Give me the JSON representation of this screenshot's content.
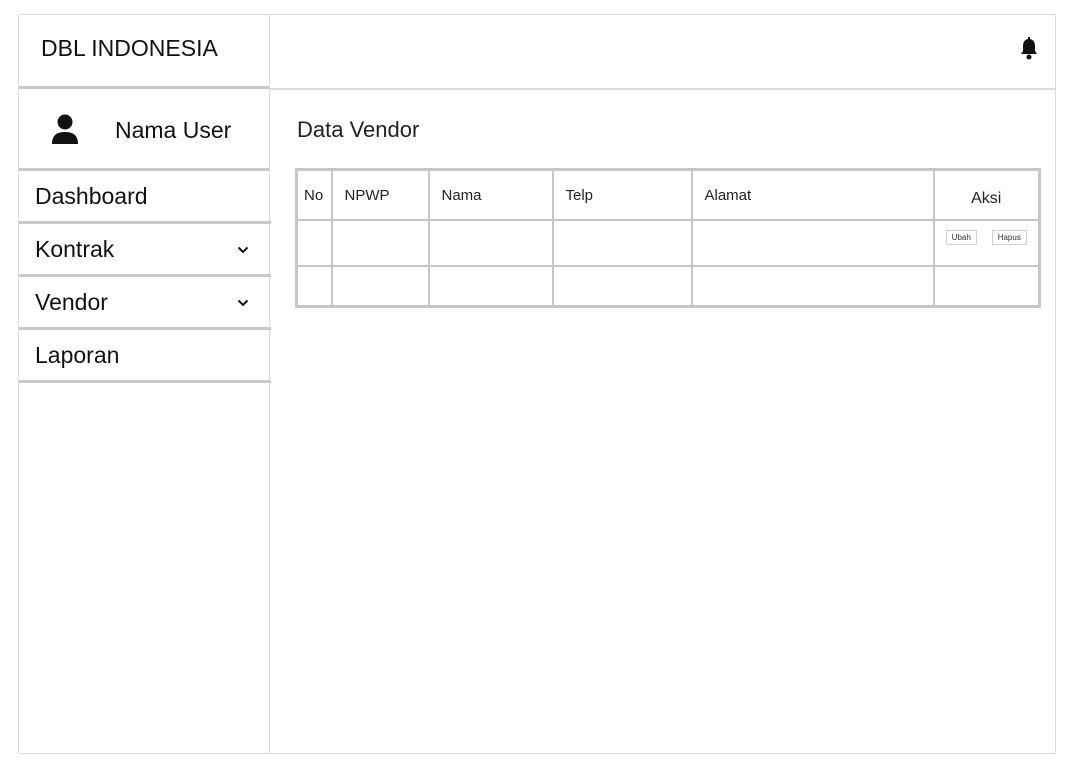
{
  "sidebar": {
    "brand": "DBL INDONESIA",
    "user_name": "Nama User",
    "items": [
      {
        "label": "Dashboard",
        "has_dropdown": false
      },
      {
        "label": "Kontrak",
        "has_dropdown": true
      },
      {
        "label": "Vendor",
        "has_dropdown": true
      },
      {
        "label": "Laporan",
        "has_dropdown": false
      }
    ]
  },
  "topbar": {
    "icon": "bell-icon"
  },
  "main": {
    "title": "Data Vendor",
    "table": {
      "columns": [
        "No",
        "NPWP",
        "Nama",
        "Telp",
        "Alamat",
        "Aksi"
      ],
      "rows": [
        {
          "no": "",
          "npwp": "",
          "nama": "",
          "telp": "",
          "alamat": "",
          "actions": [
            "Ubah",
            "Hapus"
          ]
        },
        {
          "no": "",
          "npwp": "",
          "nama": "",
          "telp": "",
          "alamat": "",
          "actions": []
        }
      ]
    }
  }
}
